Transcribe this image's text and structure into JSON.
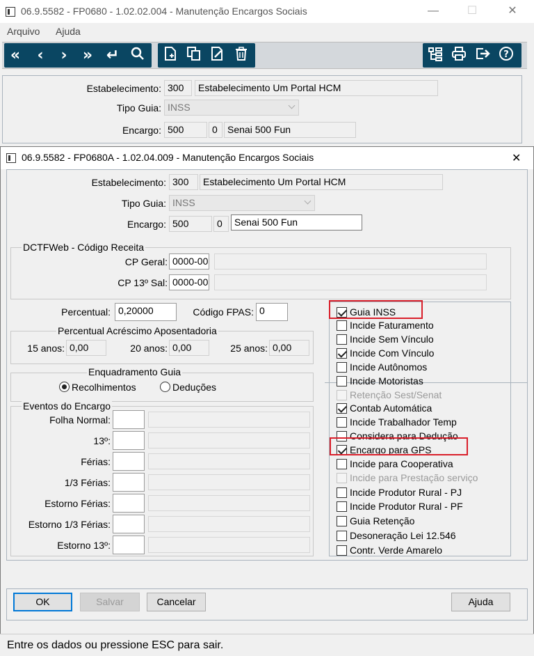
{
  "main_window": {
    "title": "06.9.5582 - FP0680 - 1.02.02.004 - Manutenção Encargos Sociais",
    "controls": {
      "minimize": "—",
      "maximize": "☐",
      "close": "✕"
    },
    "menu": [
      "Arquivo",
      "Ajuda"
    ],
    "toolbar_left": [
      "first-icon",
      "prev-icon",
      "next-icon",
      "last-icon",
      "return-icon",
      "search-icon"
    ],
    "toolbar_mid": [
      "new-doc-icon",
      "copy-icon",
      "edit-icon",
      "delete-icon"
    ],
    "toolbar_right": [
      "tree-icon",
      "print-icon",
      "exit-icon",
      "help-icon"
    ],
    "estabelecimento_label": "Estabelecimento:",
    "estabelecimento_code": "300",
    "estabelecimento_name": "Estabelecimento Um Portal HCM",
    "tipo_guia_label": "Tipo Guia:",
    "tipo_guia_value": "INSS",
    "encargo_label": "Encargo:",
    "encargo_code": "500",
    "encargo_seq": "0",
    "encargo_desc": "Senai 500 Fun"
  },
  "dialog": {
    "title": "06.9.5582 - FP0680A - 1.02.04.009 - Manutenção Encargos Sociais",
    "close": "✕",
    "estabelecimento_label": "Estabelecimento:",
    "estabelecimento_code": "300",
    "estabelecimento_name": "Estabelecimento Um Portal HCM",
    "tipo_guia_label": "Tipo Guia:",
    "tipo_guia_value": "INSS",
    "encargo_label": "Encargo:",
    "encargo_code": "500",
    "encargo_seq": "0",
    "encargo_desc": "Senai 500 Fun",
    "dctf": {
      "title": "DCTFWeb - Código Receita",
      "cp_geral_label": "CP Geral:",
      "cp_geral_value": "0000-00",
      "cp_13_label": "CP 13º Sal:",
      "cp_13_value": "0000-00"
    },
    "percentual_label": "Percentual:",
    "percentual_value": "0,20000",
    "fpas_label": "Código FPAS:",
    "fpas_value": "0",
    "acrescimo": {
      "title": "Percentual Acréscimo Aposentadoria",
      "a15_label": "15 anos:",
      "a15_value": "0,00",
      "a20_label": "20 anos:",
      "a20_value": "0,00",
      "a25_label": "25 anos:",
      "a25_value": "0,00"
    },
    "enquadramento": {
      "title": "Enquadramento Guia",
      "options": [
        "Recolhimentos",
        "Deduções"
      ],
      "selected": "Recolhimentos"
    },
    "eventos": {
      "title": "Eventos do Encargo",
      "rows": [
        "Folha Normal:",
        "13º:",
        "Férias:",
        "1/3 Férias:",
        "Estorno Férias:",
        "Estorno 1/3 Férias:",
        "Estorno 13º:"
      ]
    },
    "checkboxes": [
      {
        "label": "Guia INSS",
        "checked": true,
        "disabled": false,
        "highlighted": true
      },
      {
        "label": "Incide Faturamento",
        "checked": false,
        "disabled": false
      },
      {
        "label": "Incide Sem Vínculo",
        "checked": false,
        "disabled": false
      },
      {
        "label": "Incide Com Vínculo",
        "checked": true,
        "disabled": false
      },
      {
        "label": "Incide Autônomos",
        "checked": false,
        "disabled": false
      },
      {
        "label": "Incide Motoristas",
        "checked": false,
        "disabled": false
      },
      {
        "label": "Retenção Sest/Senat",
        "checked": false,
        "disabled": true
      },
      {
        "label": "Contab Automática",
        "checked": true,
        "disabled": false
      },
      {
        "label": "Incide Trabalhador Temp",
        "checked": false,
        "disabled": false
      },
      {
        "label": "Considera para Dedução",
        "checked": false,
        "disabled": false
      },
      {
        "label": "Encargo para GPS",
        "checked": true,
        "disabled": false,
        "highlighted": true
      },
      {
        "label": "Incide para Cooperativa",
        "checked": false,
        "disabled": false
      },
      {
        "label": "Incide para Prestação serviço",
        "checked": false,
        "disabled": true
      },
      {
        "label": "Incide Produtor Rural - PJ",
        "checked": false,
        "disabled": false
      },
      {
        "label": "Incide Produtor Rural - PF",
        "checked": false,
        "disabled": false
      },
      {
        "label": "Guia Retenção",
        "checked": false,
        "disabled": false
      },
      {
        "label": "Desoneração Lei 12.546",
        "checked": false,
        "disabled": false
      },
      {
        "label": "Contr. Verde Amarelo",
        "checked": false,
        "disabled": false
      }
    ],
    "buttons": {
      "ok": "OK",
      "salvar": "Salvar",
      "cancelar": "Cancelar",
      "ajuda": "Ajuda"
    }
  },
  "status_text": "Entre os dados ou pressione ESC para sair.",
  "colors": {
    "toolbar_button": "#0a4662",
    "highlight": "#d91e2a",
    "default_button_border": "#0078d7"
  }
}
